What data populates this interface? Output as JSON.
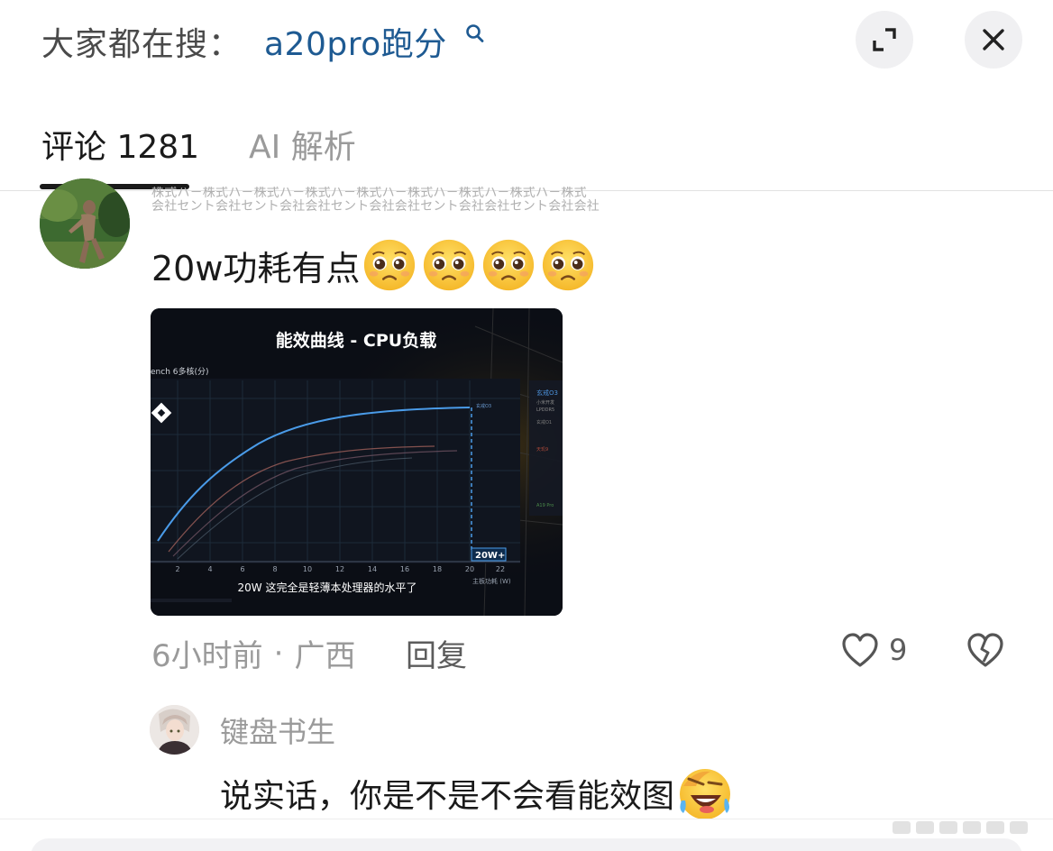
{
  "header": {
    "search_prefix": "大家都在搜：",
    "search_query": "a20pro跑分",
    "search_icon": "search-icon",
    "expand_icon": "expand-icon",
    "close_icon": "close-icon"
  },
  "tabs": [
    {
      "label": "评论 1281",
      "active": true
    },
    {
      "label": "AI 解析",
      "active": false
    }
  ],
  "comment": {
    "watermark_line1": "株式ハ－株式ハ－株式ハ－株式ハ－株式ハ－株式ハ－株式ハ－株式ハ－株式",
    "watermark_line2": "会社セント会社セント会社会社セント会社会社セント会社会社セント会社会社",
    "text": "20w功耗有点",
    "emojis": [
      "pleading-face-icon",
      "pleading-face-icon",
      "pleading-face-icon",
      "pleading-face-icon"
    ],
    "time": "6小时前",
    "separator": "·",
    "location": "广西",
    "reply_label": "回复",
    "like_count": "9"
  },
  "image": {
    "title": "能效曲线 - CPU负载",
    "y_axis_label": "ench 6多核(分)",
    "x_axis_label": "主板功耗 (W)",
    "x_ticks": [
      "2",
      "4",
      "6",
      "8",
      "10",
      "12",
      "14",
      "16",
      "18",
      "20",
      "22"
    ],
    "marker_label": "20W+",
    "caption": "20W 这完全是轻薄本处理器的水平了",
    "series_label_top": "玄戒O3",
    "right_panel": [
      "玄戒O3",
      "小米开发",
      "LPDDR5",
      "玄戒O1",
      "天玑9",
      "A19 Pro"
    ],
    "colors": {
      "main_curve": "#4a9be8",
      "other_curve": "#a0605a",
      "grid": "#1d2a3a"
    }
  },
  "reply": {
    "username": "键盘书生",
    "text": "说实话，你是不是不会看能效图",
    "emoji": "laughing-face-icon"
  }
}
